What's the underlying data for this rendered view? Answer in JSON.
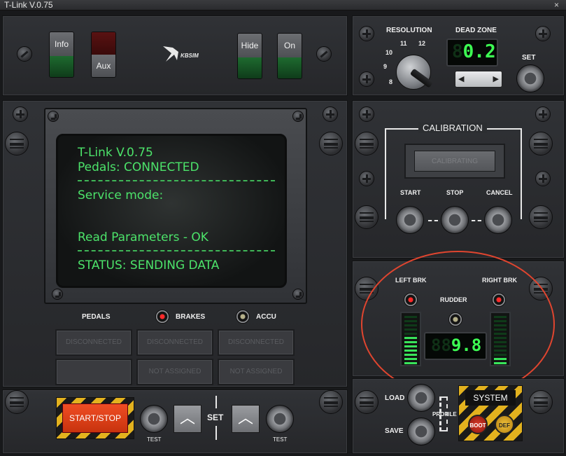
{
  "window": {
    "title": "T-Link V.0.75",
    "close_glyph": "×"
  },
  "top_left": {
    "info_label": "Info",
    "aux_label": "Aux",
    "hide_label": "Hide",
    "on_label": "On",
    "logo_text": "KBSIM"
  },
  "resolution": {
    "title": "RESOLUTION",
    "ticks": [
      "8",
      "9",
      "10",
      "11",
      "12"
    ]
  },
  "deadzone": {
    "title": "DEAD ZONE",
    "ghost_digit": "8",
    "value": "0.2",
    "spinner_left": "◀",
    "spinner_right": "▶",
    "set_label": "SET"
  },
  "display": {
    "line1": "T-Link V.0.75",
    "line2": "Pedals: CONNECTED",
    "line3": "Service mode:",
    "line4": "Read Parameters - OK",
    "line5": "STATUS: SENDING DATA"
  },
  "status_row": {
    "pedals_label": "PEDALS",
    "brakes_label": "BRAKES",
    "accu_label": "ACCU"
  },
  "slots": {
    "row1": [
      "DISCONNECTED",
      "DISCONNECTED",
      "DISCONNECTED"
    ],
    "row2": [
      "",
      "NOT ASSIGNED",
      "NOT ASSIGNED"
    ]
  },
  "bottom_controls": {
    "start_stop": "START/STOP",
    "test_left": "TEST",
    "set_label": "SET",
    "test_right": "TEST",
    "arrow_up": "︿"
  },
  "calibration": {
    "title": "CALIBRATION",
    "indicator": "CALIBRATING",
    "start": "START",
    "stop": "STOP",
    "cancel": "CANCEL"
  },
  "brakes": {
    "left": "LEFT BRK",
    "right": "RIGHT BRK",
    "rudder": "RUDDER",
    "ghost_digits": "88",
    "value": "9.8",
    "left_level": 0.55,
    "right_level": 0.2
  },
  "profile": {
    "load": "LOAD",
    "save": "SAVE",
    "profile": "PROFILE"
  },
  "system": {
    "title": "SYSTEM",
    "boot": "BOOT",
    "def": "DEF"
  },
  "colors": {
    "lcd_green": "#4ce36a",
    "led_red": "#ff2a2a",
    "start_stop": "#e0431c",
    "highlight_ring": "#e0452f",
    "hazard_yellow": "#e3b21e"
  }
}
